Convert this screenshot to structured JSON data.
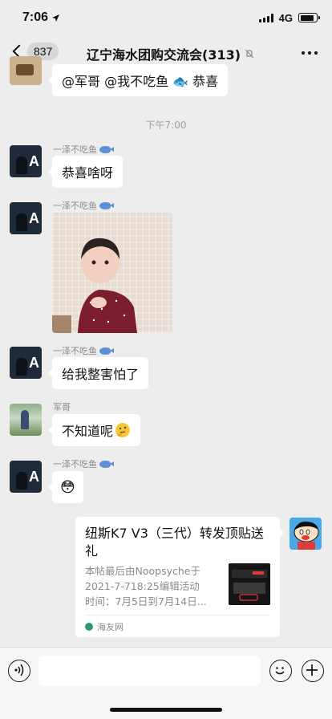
{
  "status_bar": {
    "time": "7:06",
    "network": "4G"
  },
  "nav": {
    "back_count": "837",
    "title": "辽宁海水团购交流会(313)"
  },
  "messages": {
    "m0_text": "@军哥 @我不吃鱼 🐟 恭喜",
    "timestamp": "下午7:00",
    "m1_sender": "一泽不吃鱼",
    "m1_text": "恭喜啥呀",
    "m2_sender": "一泽不吃鱼",
    "m3_sender": "一泽不吃鱼",
    "m3_text": "给我整害怕了",
    "m4_sender": "军哥",
    "m4_text": "不知道呢",
    "m5_sender": "一泽不吃鱼",
    "m5_emoji": "😳"
  },
  "card": {
    "title": "纽斯K7 V3（三代）转发顶贴送礼",
    "desc_line1": "本帖最后由Noopsyche于",
    "desc_line2": "2021-7-718:25编辑活动",
    "desc_line3": "时间：7月5日到7月14日...",
    "source": "海友网"
  },
  "input": {
    "placeholder": ""
  }
}
